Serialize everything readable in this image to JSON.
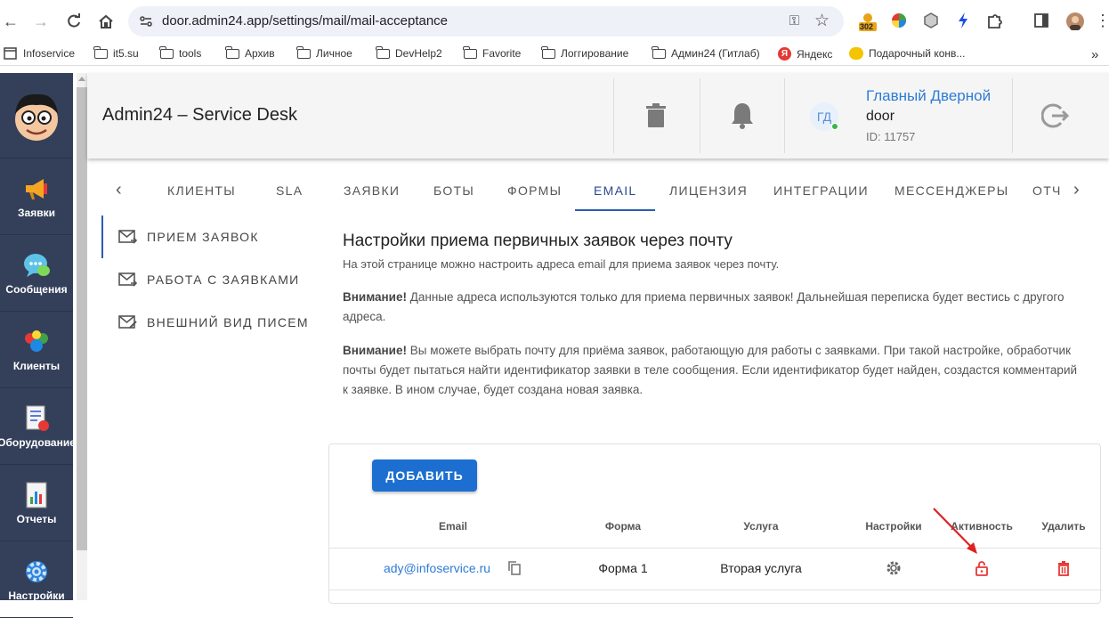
{
  "browser": {
    "url": "door.admin24.app/settings/mail/mail-acceptance",
    "extension_badge": "302",
    "bookmarks": [
      "Infoservice",
      "it5.su",
      "tools",
      "Архив",
      "Личное",
      "DevHelp2",
      "Favorite",
      "Логгирование",
      "Админ24 (Гитлаб)",
      "Яндекс",
      "Подарочный конв..."
    ]
  },
  "sidebar": {
    "items": [
      {
        "label": "Заявки",
        "icon": "megaphone-icon"
      },
      {
        "label": "Сообщения",
        "icon": "chat-icon"
      },
      {
        "label": "Клиенты",
        "icon": "clients-icon"
      },
      {
        "label": "Оборудование",
        "icon": "equipment-icon"
      },
      {
        "label": "Отчеты",
        "icon": "reports-icon"
      },
      {
        "label": "Настройки",
        "icon": "gear-icon"
      }
    ]
  },
  "header": {
    "title": "Admin24 – Service Desk",
    "user": {
      "initials": "ГД",
      "name": "Главный Дверной",
      "login": "door",
      "id": "ID: 11757"
    }
  },
  "tabs": [
    "КЛИЕНТЫ",
    "SLA",
    "ЗАЯВКИ",
    "БОТЫ",
    "ФОРМЫ",
    "EMAIL",
    "ЛИЦЕНЗИЯ",
    "ИНТЕГРАЦИИ",
    "МЕССЕНДЖЕРЫ",
    "ОТЧ"
  ],
  "settings_menu": [
    "ПРИЕМ ЗАЯВОК",
    "РАБОТА С ЗАЯВКАМИ",
    "ВНЕШНИЙ ВИД ПИСЕМ"
  ],
  "content": {
    "title": "Настройки приема первичных заявок через почту",
    "subtitle": "На этой странице можно настроить адреса email для приема заявок через почту.",
    "warn_label": "Внимание!",
    "warn1": " Данные адреса используются только для приема первичных заявок! Дальнейшая переписка будет вестись с другого адреса.",
    "warn2": " Вы можете выбрать почту для приёма заявок, работающую для работы с заявками. При такой настройке, обработчик почты будет пытаться найти идентификатор заявки в теле сообщения. Если идентификатор будет найден, создастся комментарий к заявке. В ином случае, будет создана новая заявка."
  },
  "table": {
    "add_label": "ДОБАВИТЬ",
    "headers": [
      "Email",
      "Форма",
      "Услуга",
      "Настройки",
      "Активность",
      "Удалить"
    ],
    "rows": [
      {
        "email": "ady@infoservice.ru",
        "form": "Форма 1",
        "service": "Вторая услуга"
      }
    ]
  },
  "colors": {
    "accent": "#1c6fd0",
    "sidebar": "#34405a",
    "danger": "#e53935",
    "annotation": "#e02020"
  }
}
